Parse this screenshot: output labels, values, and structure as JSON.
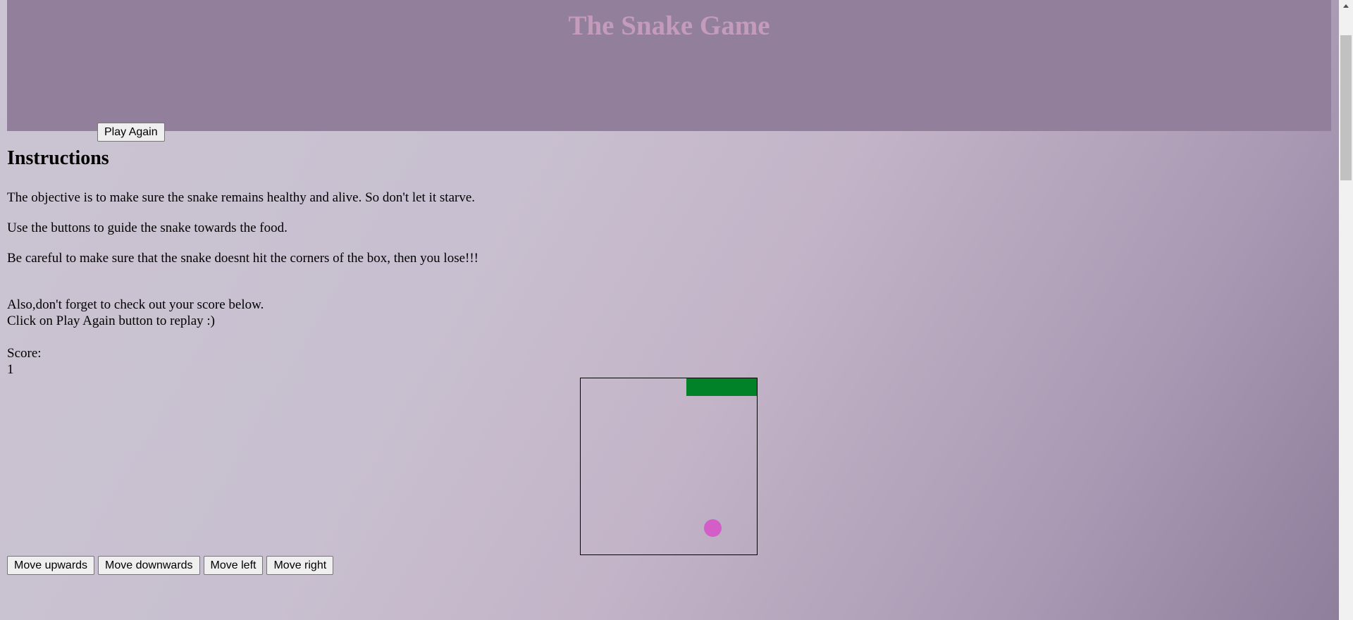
{
  "header": {
    "title": "The Snake Game",
    "background_color": "#917f9c",
    "title_color": "#c49bbb"
  },
  "play_again_label": "Play Again",
  "instructions": {
    "heading": "Instructions",
    "line1": "The objective is to make sure the snake remains healthy and alive. So don't let it starve.",
    "line2": "Use the buttons to guide the snake towards the food.",
    "line3": "Be careful to make sure that the snake doesnt hit the corners of the box, then you lose!!!",
    "line4": "Also,don't forget to check out your score below.",
    "line5": "Click on Play Again button to replay :)"
  },
  "score": {
    "label": "Score:",
    "value": "1"
  },
  "game": {
    "grid_cells": 10,
    "snake": [
      {
        "col": 6,
        "row": 0
      },
      {
        "col": 7,
        "row": 0
      },
      {
        "col": 8,
        "row": 0
      },
      {
        "col": 9,
        "row": 0
      }
    ],
    "food": {
      "col": 7,
      "row": 8
    },
    "snake_color": "#018128",
    "food_color": "#d45ec7"
  },
  "controls": {
    "up": "Move upwards",
    "down": "Move downwards",
    "left": "Move left",
    "right": "Move right"
  }
}
